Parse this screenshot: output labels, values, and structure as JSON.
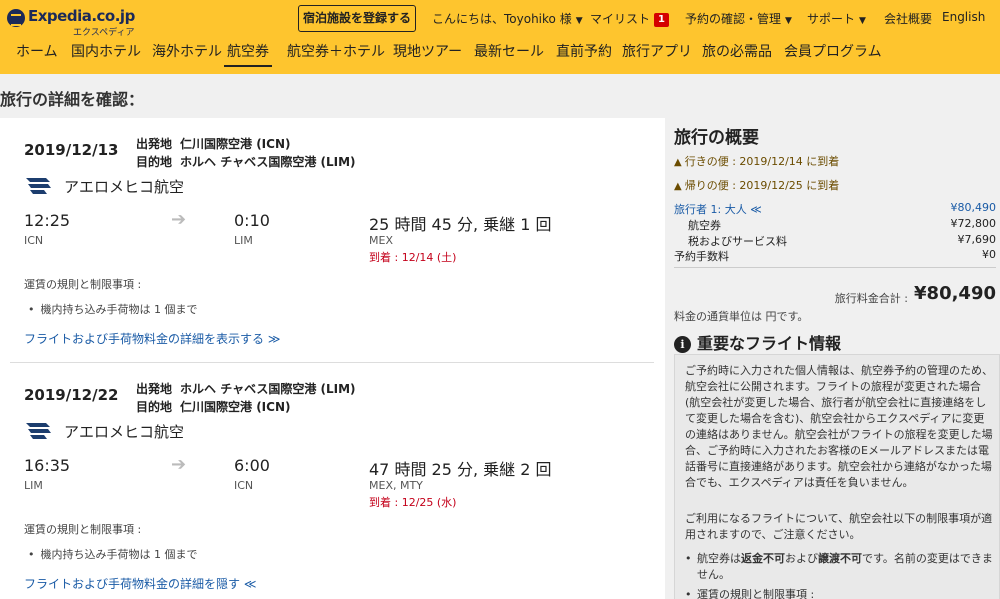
{
  "header": {
    "logo_name": "Expedia.co.jp",
    "logo_sub": "エクスペディア",
    "register_button": "宿泊施設を登録する",
    "greeting": "こんにちは、Toyohiko 様",
    "mylist": "マイリスト",
    "mylist_count": "1",
    "trips": "予約の確認・管理",
    "support": "サポート",
    "company": "会社概要",
    "language": "English",
    "nav": [
      "ホーム",
      "国内ホテル",
      "海外ホテル",
      "航空券",
      "航空券＋ホテル",
      "現地ツアー",
      "最新セール",
      "直前予約",
      "旅行アプリ",
      "旅の必需品",
      "会員プログラム"
    ],
    "nav_active_index": 3
  },
  "page_title": "旅行の詳細を確認：",
  "flights": [
    {
      "date": "2019/12/13",
      "from_label": "出発地",
      "from_value": "仁川国際空港 (ICN)",
      "to_label": "目的地",
      "to_value": "ホルヘ チャベス国際空港 (LIM)",
      "airline": "アエロメヒコ航空",
      "dep_time": "12:25",
      "dep_code": "ICN",
      "arr_time": "0:10",
      "arr_code": "LIM",
      "duration": "25 時間 45 分, 乗継 1 回",
      "via": "MEX",
      "arrival_note": "到着 : 12/14 (土)",
      "rules_title": "運賃の規則と制限事項 :",
      "rule_item": "機内持ち込み手荷物は 1 個まで",
      "detail_link": "フライトおよび手荷物料金の詳細を表示する ≫"
    },
    {
      "date": "2019/12/22",
      "from_label": "出発地",
      "from_value": "ホルヘ チャベス国際空港 (LIM)",
      "to_label": "目的地",
      "to_value": "仁川国際空港 (ICN)",
      "airline": "アエロメヒコ航空",
      "dep_time": "16:35",
      "dep_code": "LIM",
      "arr_time": "6:00",
      "arr_code": "ICN",
      "duration": "47 時間 25 分, 乗継 2 回",
      "via": "MEX, MTY",
      "arrival_note": "到着 : 12/25 (水)",
      "rules_title": "運賃の規則と制限事項 :",
      "rule_item": "機内持ち込み手荷物は 1 個まで",
      "detail_link": "フライトおよび手荷物料金の詳細を隠す ≪"
    }
  ],
  "summary": {
    "title": "旅行の概要",
    "outbound_warn": "行きの便 : 2019/12/14 に到着",
    "return_warn": "帰りの便 : 2019/12/25 に到着",
    "travelers_label": "旅行者 1: 大人 ≪",
    "travelers_amount": "¥80,490",
    "airfare_label": "航空券",
    "airfare_amount": "¥72,800",
    "tax_label": "税およびサービス料",
    "tax_amount": "¥7,690",
    "fee_label": "予約手数料",
    "fee_amount": "¥0",
    "total_label": "旅行料金合計 :",
    "total_amount": "¥80,490",
    "currency_note": "料金の通貨単位は 円です。"
  },
  "info": {
    "heading": "重要なフライト情報",
    "para1": "ご予約時に入力された個人情報は、航空券予約の管理のため、航空会社に公開されます。フライトの旅程が変更された場合 (航空会社が変更した場合、旅行者が航空会社に直接連絡をして変更した場合を含む)、航空会社からエクスペディアに変更の連絡はありません。航空会社がフライトの旅程を変更した場合、ご予約時に入力されたお客様のEメールアドレスまたは電話番号に直接連絡があります。航空会社から連絡がなかった場合でも、エクスペディアは責任を負いません。",
    "para2": "ご利用になるフライトについて、航空会社以下の制限事項が適用されますので、ご注意ください。",
    "li1_pre": "航空券は",
    "li1_b1": "返金不可",
    "li1_mid": "および",
    "li1_b2": "譲渡不可",
    "li1_post": "です。名前の変更はできません。",
    "li2": "運賃の規則と制限事項 :"
  },
  "colors": {
    "brand_yellow": "#fec52e",
    "link_blue": "#1a5ba6",
    "arrival_red": "#c4001a",
    "warn_brown": "#6b4c00"
  }
}
